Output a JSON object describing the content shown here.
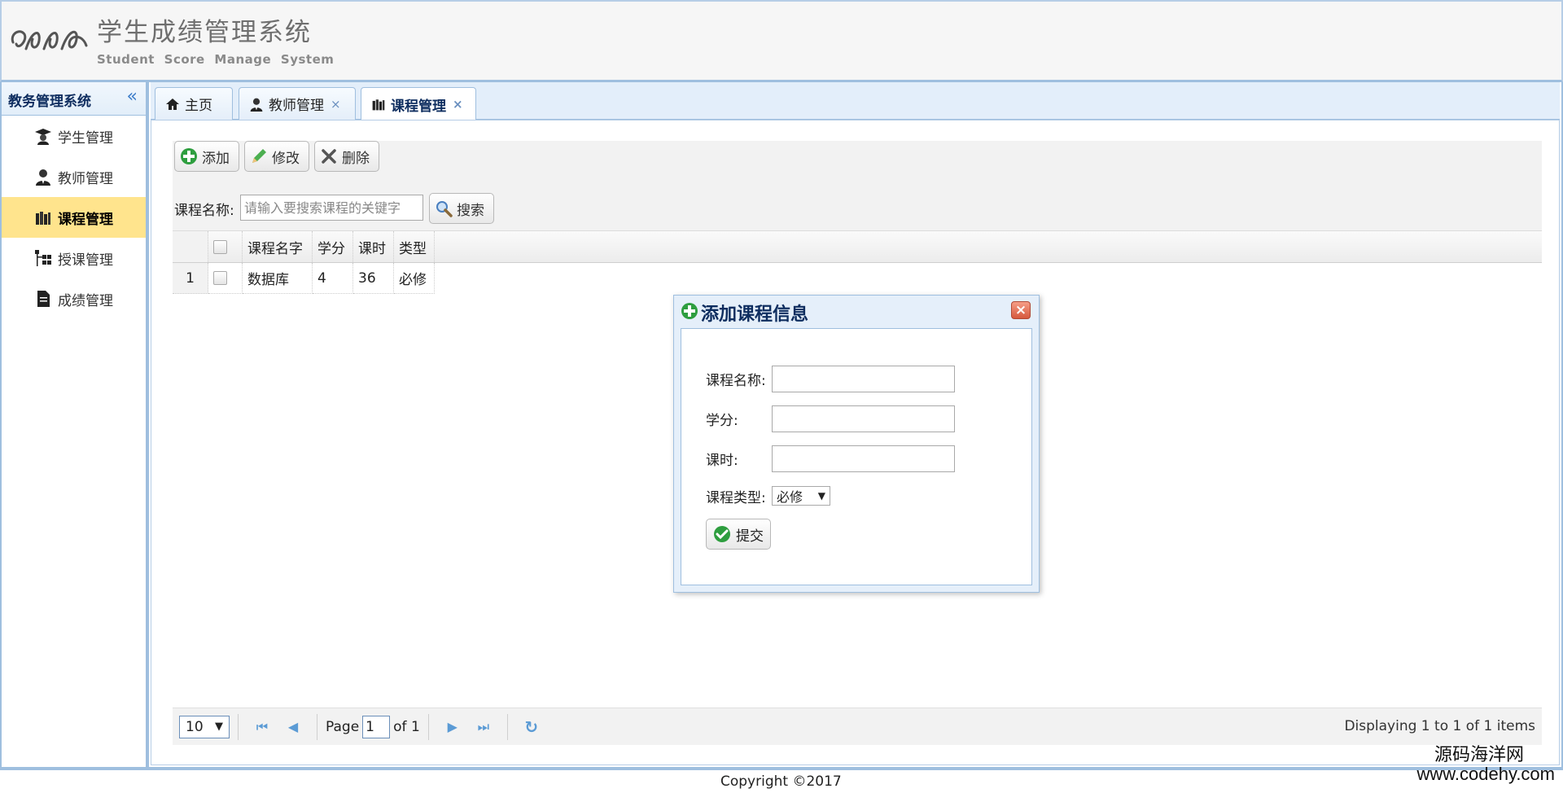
{
  "header": {
    "title": "学生成绩管理系统",
    "subtitle": "Student Score Manage System"
  },
  "sidebar": {
    "title": "教务管理系统",
    "items": [
      {
        "label": "学生管理",
        "icon": "student-cap-icon",
        "active": false
      },
      {
        "label": "教师管理",
        "icon": "teacher-icon",
        "active": false
      },
      {
        "label": "课程管理",
        "icon": "books-icon",
        "active": true
      },
      {
        "label": "授课管理",
        "icon": "hierarchy-icon",
        "active": false
      },
      {
        "label": "成绩管理",
        "icon": "document-icon",
        "active": false
      }
    ]
  },
  "tabs": [
    {
      "label": "主页",
      "icon": "home-icon",
      "closable": false
    },
    {
      "label": "教师管理",
      "icon": "teacher-icon",
      "closable": true
    },
    {
      "label": "课程管理",
      "icon": "books-icon",
      "closable": true,
      "active": true
    }
  ],
  "toolbar": {
    "add_label": "添加",
    "edit_label": "修改",
    "delete_label": "删除",
    "search_label": "课程名称:",
    "search_placeholder": "请输入要搜索课程的关键字",
    "search_button": "搜索"
  },
  "grid": {
    "columns": [
      "课程名字",
      "学分",
      "课时",
      "类型"
    ],
    "rows": [
      {
        "num": "1",
        "name": "数据库",
        "credit": "4",
        "hours": "36",
        "type": "必修"
      }
    ]
  },
  "pager": {
    "page_size": "10",
    "page_label": "Page",
    "page_value": "1",
    "of_label": "of 1",
    "info": "Displaying 1 to 1 of 1 items"
  },
  "dialog": {
    "title": "添加课程信息",
    "name_label": "课程名称:",
    "credit_label": "学分:",
    "hours_label": "课时:",
    "type_label": "课程类型:",
    "type_value": "必修",
    "submit_label": "提交"
  },
  "footer": {
    "copyright": "Copyright ©2017",
    "watermark_line1": "源码海洋网",
    "watermark_line2": "www.codehy.com"
  },
  "colors": {
    "border": "#9fbfdf",
    "active_nav": "#ffe48d",
    "tab_bar": "#e3eefa",
    "title_text": "#0e2d5f"
  }
}
